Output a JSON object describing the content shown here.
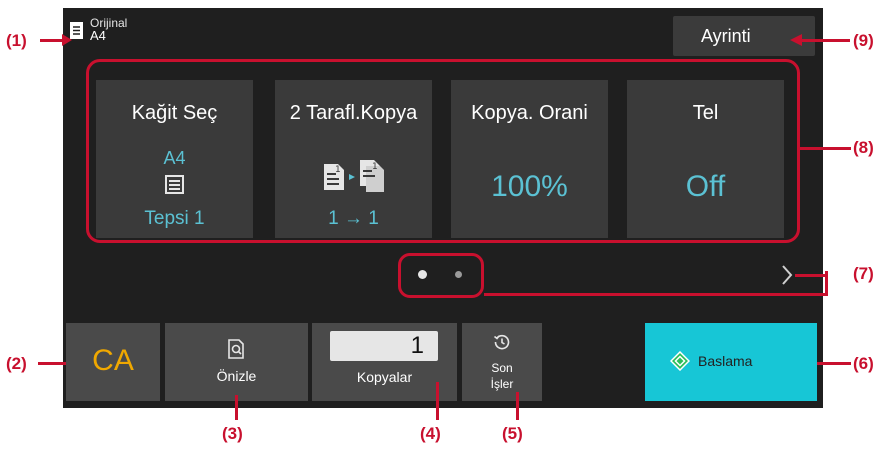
{
  "callouts": {
    "c1": "(1)",
    "c2": "(2)",
    "c3": "(3)",
    "c4": "(4)",
    "c5": "(5)",
    "c6": "(6)",
    "c7": "(7)",
    "c8": "(8)",
    "c9": "(9)"
  },
  "header": {
    "original_label": "Orijinal",
    "original_size": "A4",
    "detail_button": "Ayrinti"
  },
  "cards": [
    {
      "title": "Kağit Seç",
      "top_value": "A4",
      "bottom_value": "Tepsi 1",
      "icon": "paper-tray-icon"
    },
    {
      "title": "2 Tarafl.Kopya",
      "bottom_value": "1 → 1",
      "icon": "duplex-copy-icon"
    },
    {
      "title": "Kopya. Orani",
      "value": "100%"
    },
    {
      "title": "Tel",
      "value": "Off"
    }
  ],
  "pager": {
    "pages": 2,
    "current": 1,
    "next_icon": "chevron-right-icon"
  },
  "bottom": {
    "ca_label": "CA",
    "preview_label": "Önizle",
    "copies_value": "1",
    "copies_label": "Kopyalar",
    "recent_label_1": "Son",
    "recent_label_2": "İşler",
    "start_label": "Baslama"
  },
  "colors": {
    "callout": "#c8102e",
    "accent_text": "#5bc1d3",
    "ca_text": "#f0a800",
    "start_button": "#17c6d6",
    "panel": "#1f1f1f"
  }
}
